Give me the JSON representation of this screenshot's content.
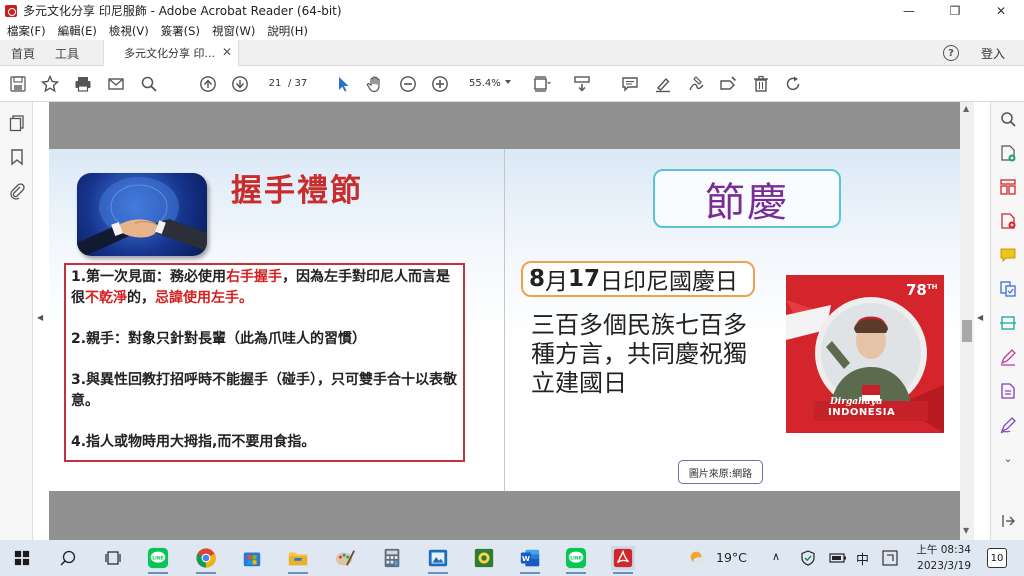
{
  "window": {
    "title": "多元文化分享 印尼服飾 - Adobe Acrobat Reader (64-bit)",
    "controls": {
      "minimize": "—",
      "maximize": "❐",
      "close": "✕"
    }
  },
  "menu": [
    "檔案(F)",
    "編輯(E)",
    "檢視(V)",
    "簽署(S)",
    "視窗(W)",
    "說明(H)"
  ],
  "tabs": {
    "home": "首頁",
    "tools": "工具",
    "doc": "多元文化分享 印...",
    "close": "✕"
  },
  "header_right": {
    "help": "?",
    "signin": "登入"
  },
  "toolbar": {
    "page_current": "21",
    "page_total": "/ 37",
    "zoom": "55.4%"
  },
  "slide_left": {
    "heading": "握手禮節",
    "rule1_prefix": "1.第一次見面：務必使用",
    "rule1_red1": "右手握手",
    "rule1_mid": "，因為左手對印尼人而言是很",
    "rule1_red2": "不乾淨",
    "rule1_mid2": "的，",
    "rule1_red3": "忌諱使用左手",
    "rule1_end": "。",
    "rule2": "2.親手：對象只針對長輩（此為爪哇人的習慣）",
    "rule3": "3.與異性回教打招呼時不能握手（碰手），只可雙手合十以表敬意。",
    "rule4": "4.指人或物時用大拇指,而不要用食指。"
  },
  "slide_right": {
    "heading": "節慶",
    "nat_day_num1": "8",
    "nat_day_mid": "月",
    "nat_day_num2": "17",
    "nat_day_end": "日印尼國慶日",
    "ethnic_text": "三百多個民族七百多種方言，共同慶祝獨立建國日",
    "poster_badge": "78",
    "poster_badge_sup": "TH",
    "poster_script": "Dirgahayu",
    "poster_country": "INDONESIA",
    "source": "圖片來原:網路"
  },
  "taskbar": {
    "temperature": "19°C",
    "ime": "中",
    "time": "上午 08:34",
    "date": "2023/3/19",
    "notifications": "10"
  },
  "colors": {
    "accent_red": "#d42020",
    "heading_purple": "#7a2c95",
    "acrobat_red": "#c8201e"
  }
}
